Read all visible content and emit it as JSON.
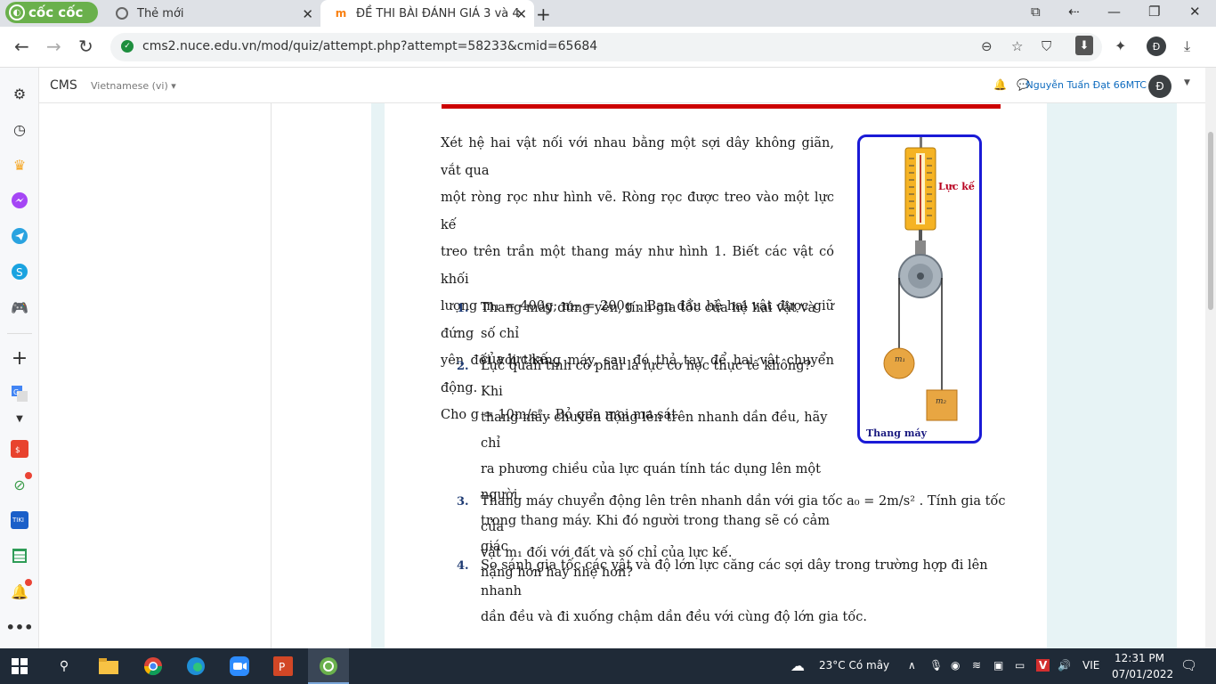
{
  "browser": {
    "brand": "cốc cốc",
    "tabs": [
      {
        "title": "Thẻ mới",
        "active": false
      },
      {
        "title": "ĐỀ THI BÀI ĐÁNH GIÁ 3 và 4",
        "active": true
      }
    ],
    "url": "cms2.nuce.edu.vn/mod/quiz/attempt.php?attempt=58233&cmid=65684",
    "profile_letter": "Đ"
  },
  "moodle": {
    "site": "CMS",
    "language": "Vietnamese (vi)",
    "user_name": "Nguyễn Tuấn Đạt 66MTC",
    "user_initial": "Đ"
  },
  "question": {
    "intro_lines": [
      "Xét hệ hai vật nối với nhau bằng một sợi dây không giãn, vắt qua",
      "một ròng rọc như hình vẽ. Ròng rọc được treo vào một lực kế",
      "treo trên trần một thang máy như hình 1. Biết các vật có khối",
      "lượng  m₁ = 400g; m₂ = 200g . Ban đầu hệ hai vật được giữ đứng",
      "yên đối với thang máy, sau đó thả tay để hai vật chuyển động.",
      "Cho  g = 10m/s² . Bỏ qua mọi ma sát."
    ],
    "items": [
      {
        "num": "1.",
        "lines": [
          "Thang máy đứng yên, tính gia tốc của hệ hai vật và số chỉ",
          "của lực kế."
        ]
      },
      {
        "num": "2.",
        "lines": [
          "Lực quán tính có phải là lực cơ học thực tế không? Khi",
          "thang máy chuyển động lên trên nhanh dần đều, hãy chỉ",
          "ra phương chiều của lực quán tính tác dụng lên một người",
          "trong thang máy. Khi đó người trong thang sẽ có cảm giác",
          "nặng hơn hay nhẹ hơn?"
        ]
      },
      {
        "num": "3.",
        "lines": [
          "Thang máy chuyển động lên trên nhanh dần với gia tốc  a₀ = 2m/s² . Tính gia tốc của",
          "vật  m₁  đối với đất và số chỉ của lực kế."
        ]
      },
      {
        "num": "4.",
        "lines": [
          "So sánh gia tốc các vật và độ lớn lực căng các sợi dây trong trường hợp đi lên nhanh",
          "dần đều và đi xuống chậm dần đều với cùng độ lớn gia tốc."
        ]
      }
    ],
    "figure": {
      "scale_label": "Lực kế",
      "mass1_label": "m₁",
      "mass2_label": "m₂",
      "elevator_label": "Thang máy",
      "colors": {
        "frame": "#1a1ad6",
        "scale": "#f5b324",
        "label": "#b8001f",
        "mass": "#e8a642"
      }
    }
  },
  "taskbar": {
    "weather": "23°C  Có mây",
    "language": "VIE",
    "time": "12:31 PM",
    "date": "07/01/2022"
  }
}
